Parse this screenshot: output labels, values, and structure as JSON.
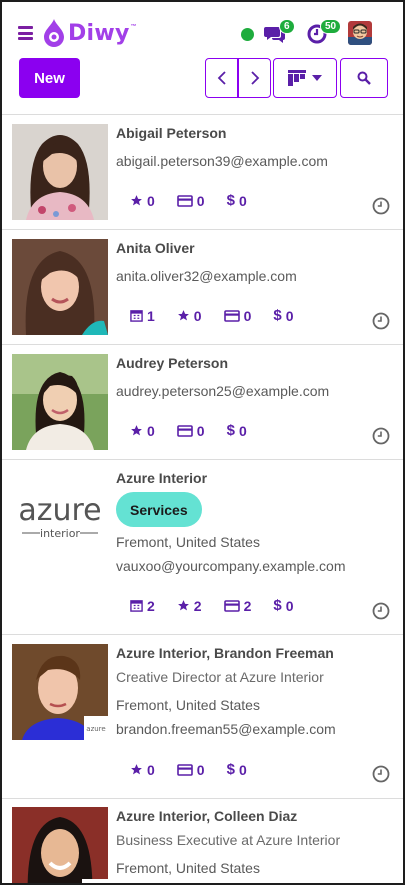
{
  "app": {
    "logo_text": "Diwy",
    "logo_tm": "™",
    "brand_color": "#8b00f0",
    "accent_green": "#1eac3d",
    "tag_color": "#64e2d3"
  },
  "topbar": {
    "messages_badge": "6",
    "activities_badge": "50",
    "new_label": "New",
    "icons": [
      "hamburger-icon",
      "chat-icon",
      "clock-icon",
      "avatar",
      "chevron-left-icon",
      "chevron-right-icon",
      "kanban-icon",
      "search-icon"
    ]
  },
  "contacts": [
    {
      "name": "Abigail Peterson",
      "lines": [
        "abigail.peterson39@example.com"
      ],
      "stats": {
        "stars": "0",
        "cards": "0",
        "money": "0"
      }
    },
    {
      "name": "Anita Oliver",
      "lines": [
        "anita.oliver32@example.com"
      ],
      "stats": {
        "meetings": "1",
        "stars": "0",
        "cards": "0",
        "money": "0"
      }
    },
    {
      "name": "Audrey Peterson",
      "lines": [
        "audrey.peterson25@example.com"
      ],
      "stats": {
        "stars": "0",
        "cards": "0",
        "money": "0"
      }
    },
    {
      "name": "Azure Interior",
      "tag": "Services",
      "logo_word": "azure",
      "logo_sub": "interior",
      "lines": [
        "Fremont, United States",
        "vauxoo@yourcompany.example.com"
      ],
      "stats": {
        "meetings": "2",
        "stars": "2",
        "cards": "2",
        "money": "0"
      }
    },
    {
      "name": "Azure Interior, Brandon Freeman",
      "lines": [
        "Creative Director at Azure Interior",
        "Fremont, United States",
        "brandon.freeman55@example.com"
      ],
      "stats": {
        "stars": "0",
        "cards": "0",
        "money": "0"
      }
    },
    {
      "name": "Azure Interior, Colleen Diaz",
      "lines": [
        "Business Executive at Azure Interior",
        "Fremont, United States"
      ]
    }
  ],
  "stat_prefix_money": "$"
}
